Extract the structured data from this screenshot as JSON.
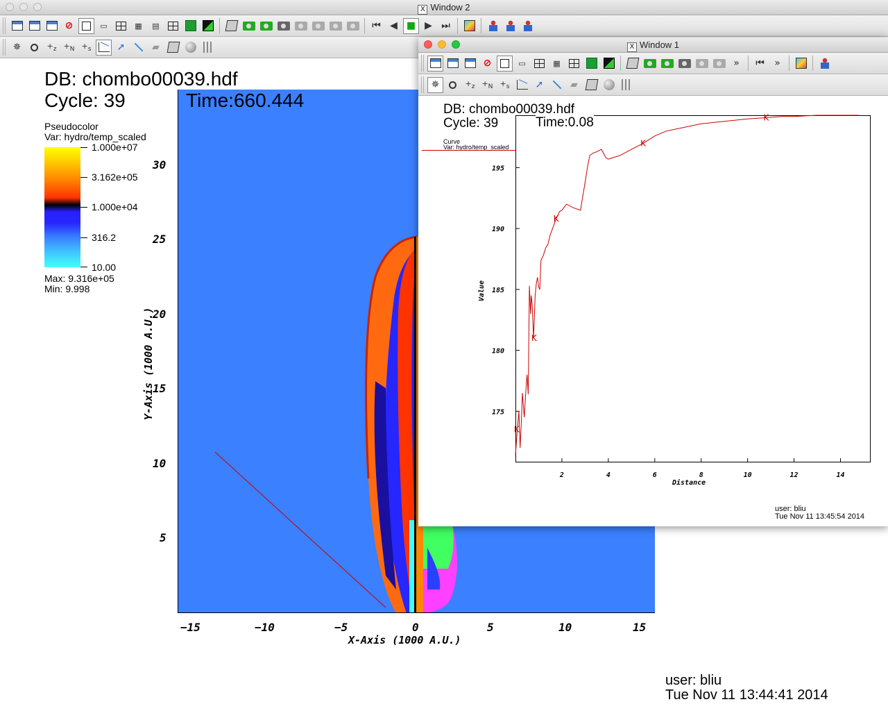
{
  "window2": {
    "title": "Window 2",
    "db_label": "DB: chombo00039.hdf",
    "cycle_label": "Cycle: 39",
    "time_label": "Time:660.444",
    "legend": {
      "plot_type": "Pseudocolor",
      "var_label": "Var: hydro/temp_scaled",
      "ticks": [
        "1.000e+07",
        "3.162e+05",
        "1.000e+04",
        "316.2",
        "10.00"
      ],
      "max_label": "Max:  9.316e+05",
      "min_label": "Min:  9.998"
    },
    "x_axis_title": "X-Axis (1000 A.U.)",
    "y_axis_title": "Y-Axis (1000 A.U.)",
    "x_ticks": [
      "−15",
      "−10",
      "−5",
      "0",
      "5",
      "10",
      "15"
    ],
    "y_ticks": [
      "5",
      "10",
      "15",
      "20",
      "25",
      "30"
    ],
    "user_label": "user: bliu",
    "date_label": "Tue Nov 11 13:44:41 2014",
    "colors": {
      "background": "#3a80ff",
      "line": "#cc0000"
    }
  },
  "window1": {
    "title": "Window 1",
    "db_label": "DB: chombo00039.hdf",
    "cycle_label": "Cycle: 39",
    "time_label": "Time:0.08",
    "legend_plot_type": "Curve",
    "legend_var": "Var: hydro/temp_scaled",
    "x_axis_title": "Distance",
    "y_axis_title": "Value",
    "user_label": "user: bliu",
    "date_label": "Tue Nov 11 13:45:54 2014",
    "overflow_label": "»"
  },
  "chart_data": {
    "type": "line",
    "xlabel": "Distance",
    "ylabel": "Value",
    "xlim": [
      0,
      15.3
    ],
    "ylim": [
      170.8,
      199.3
    ],
    "x_ticks": [
      2,
      4,
      6,
      8,
      10,
      12,
      14
    ],
    "y_ticks": [
      175,
      180,
      185,
      190,
      195
    ],
    "series": [
      {
        "color": "#cc0000",
        "marker_label": "K",
        "x": [
          0,
          0.08,
          0.15,
          0.2,
          0.25,
          0.3,
          0.38,
          0.45,
          0.5,
          0.55,
          0.6,
          0.65,
          0.68,
          0.72,
          0.78,
          0.85,
          0.9,
          0.95,
          1.0,
          1.05,
          1.1,
          1.2,
          1.3,
          1.4,
          1.5,
          1.6,
          1.75,
          1.9,
          2.0,
          2.2,
          2.5,
          2.8,
          3.0,
          3.1,
          3.2,
          3.35,
          3.5,
          3.7,
          3.9,
          4.0,
          4.5,
          5.0,
          5.5,
          6.0,
          6.5,
          7.0,
          7.5,
          8.0,
          8.5,
          9.0,
          9.5,
          10.0,
          10.8,
          11.5,
          12.0,
          13.0,
          14.0,
          14.8
        ],
        "y": [
          171.4,
          173.5,
          175.0,
          172.0,
          174.0,
          176.5,
          174.5,
          176.8,
          178.0,
          176.4,
          185.3,
          183.0,
          184.5,
          183.8,
          181.0,
          184.5,
          185.5,
          186.0,
          185.2,
          185.0,
          187.4,
          187.8,
          188.4,
          188.7,
          189.5,
          190.0,
          190.8,
          191.4,
          191.5,
          192.0,
          191.7,
          191.5,
          193.8,
          195.0,
          196.0,
          196.2,
          196.3,
          196.5,
          195.8,
          195.7,
          196.0,
          196.5,
          197.0,
          197.6,
          198.0,
          198.2,
          198.4,
          198.6,
          198.7,
          198.8,
          198.9,
          199.0,
          199.1,
          199.2,
          199.2,
          199.3,
          199.3,
          199.3
        ],
        "marker_x": [
          0.05,
          0.8,
          1.75,
          5.5,
          10.8
        ]
      }
    ]
  }
}
